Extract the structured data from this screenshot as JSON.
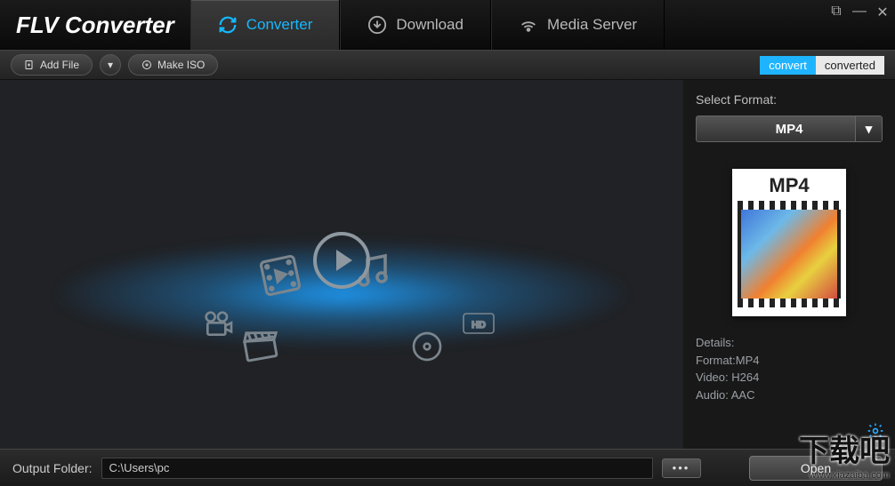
{
  "app": {
    "title": "FLV Converter"
  },
  "tabs": {
    "converter": "Converter",
    "download": "Download",
    "mediaserver": "Media Server"
  },
  "toolbar": {
    "add_file": "Add File",
    "make_iso": "Make ISO",
    "seg_convert": "convert",
    "seg_converted": "converted"
  },
  "side": {
    "select_format": "Select Format:",
    "format_value": "MP4",
    "thumb_label": "MP4",
    "details_heading": "Details:",
    "details_format": "Format:MP4",
    "details_video": "Video: H264",
    "details_audio": "Audio: AAC"
  },
  "footer": {
    "label": "Output Folder:",
    "path": "C:\\Users\\pc",
    "browse": "•••",
    "open": "Open"
  },
  "watermark": {
    "big": "下载吧",
    "url": "www.xiazaiba.com"
  }
}
